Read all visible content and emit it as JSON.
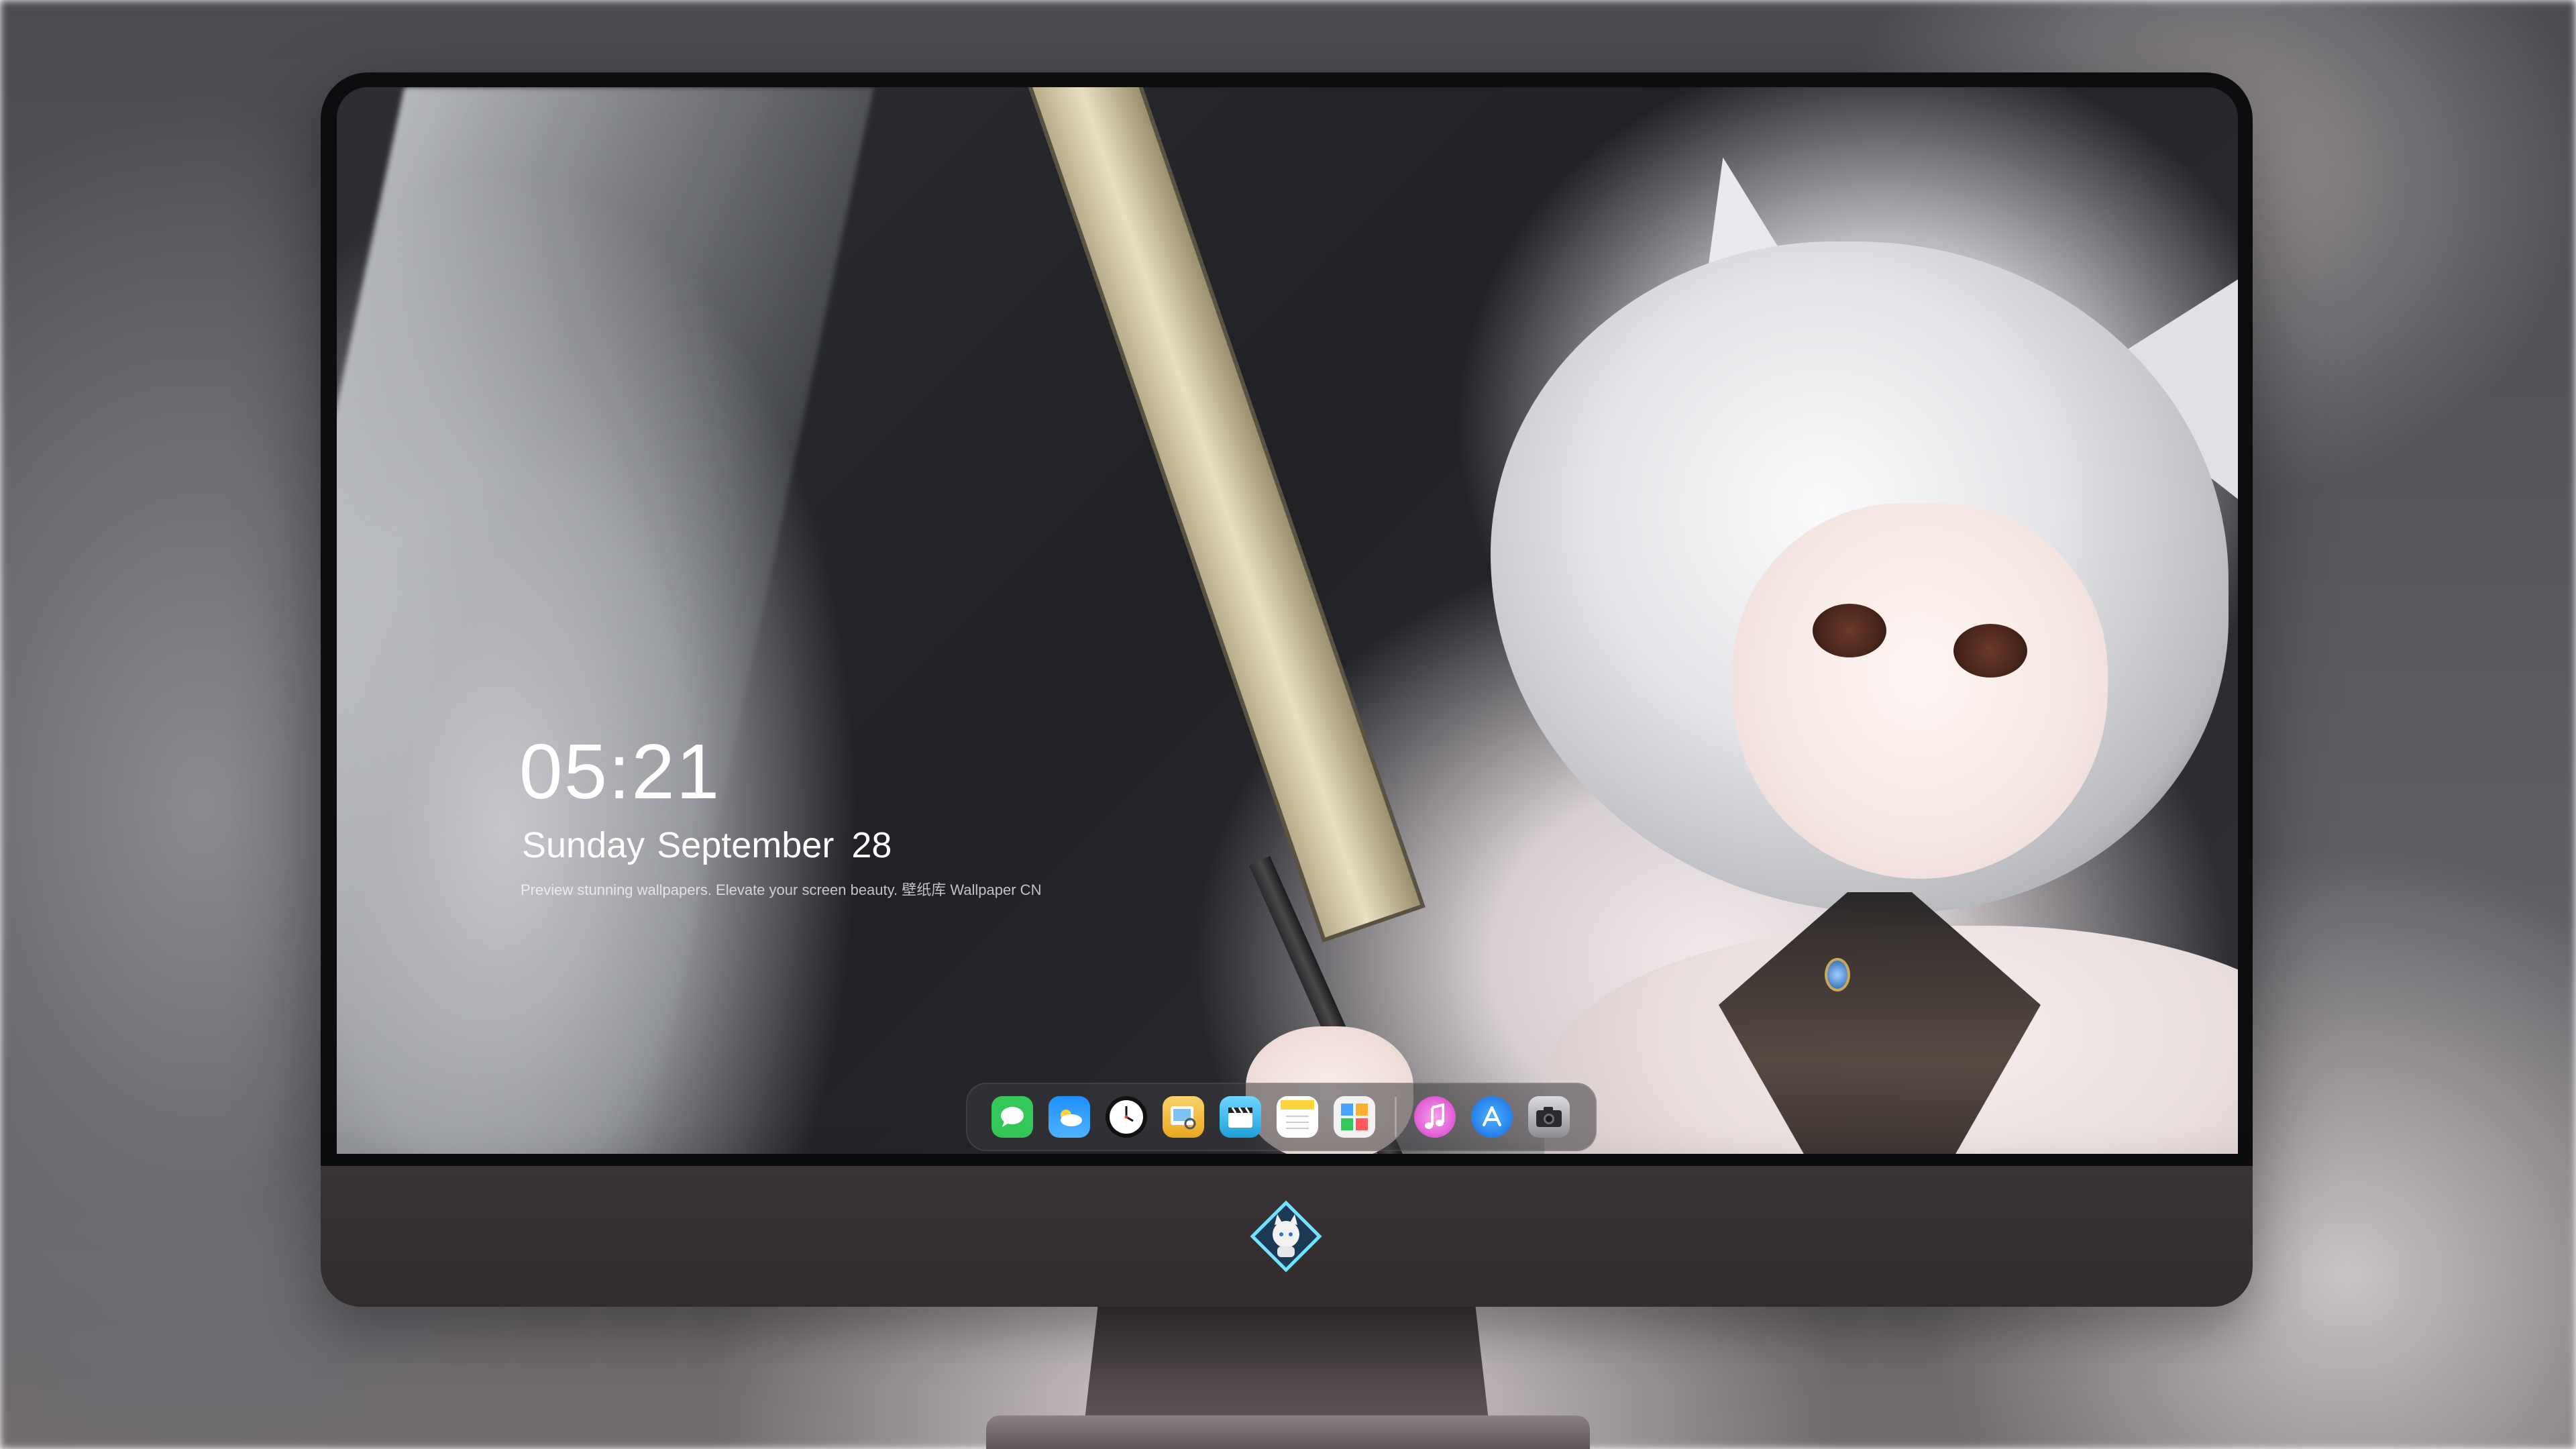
{
  "lockscreen": {
    "time": "05:21",
    "date": {
      "weekday": "Sunday",
      "month": "September",
      "day": "28"
    },
    "tagline": "Preview stunning wallpapers. Elevate your screen beauty. 壁纸库 Wallpaper CN"
  },
  "dock": {
    "apps": [
      {
        "name": "Messages",
        "icon": "messages-icon",
        "color": "#34c759"
      },
      {
        "name": "Weather",
        "icon": "weather-icon",
        "color": "#1e90ff"
      },
      {
        "name": "Clock",
        "icon": "clock-icon",
        "color": "#111111"
      },
      {
        "name": "Preview",
        "icon": "preview-icon",
        "color": "#f4c542"
      },
      {
        "name": "Clips",
        "icon": "clapperboard-icon",
        "color": "#33b7e8"
      },
      {
        "name": "Notes",
        "icon": "notes-icon",
        "color": "#ffd43b"
      },
      {
        "name": "Photos",
        "icon": "photo-collage-icon",
        "color": "#ffffff"
      },
      {
        "name": "Music",
        "icon": "music-icon",
        "color": "#e94cd1"
      },
      {
        "name": "App Store",
        "icon": "app-store-icon",
        "color": "#1a8cff"
      },
      {
        "name": "Camera",
        "icon": "camera-icon",
        "color": "#8e8e93"
      }
    ]
  },
  "monitor": {
    "logo": "mascot-logo-icon"
  }
}
